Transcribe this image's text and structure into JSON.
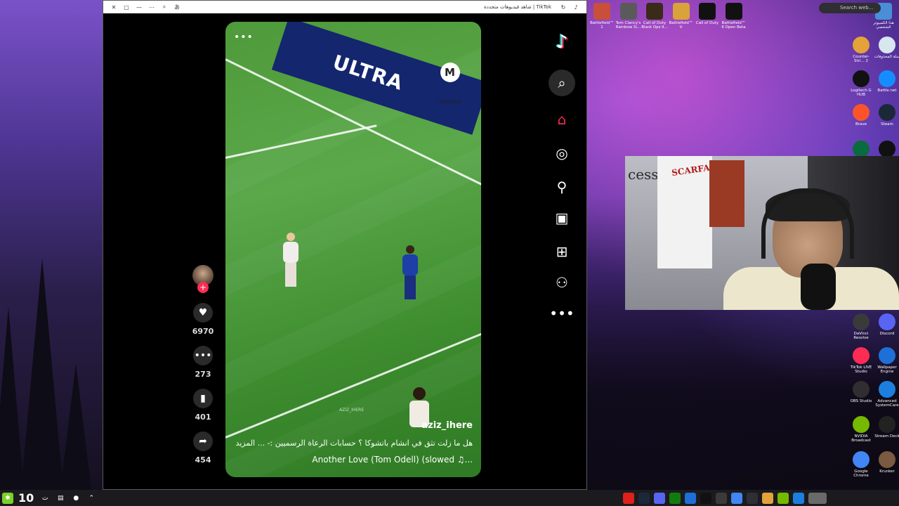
{
  "browser": {
    "title": "TikTok | شاهد فيديوهات متجددة",
    "controls": [
      "close",
      "restore",
      "minimize",
      "more",
      "zoom",
      "reader"
    ]
  },
  "video": {
    "banner_text": "ULTRA",
    "sponsor_label": "TASOOMA",
    "author": "aziz_ihere",
    "caption": "هل ما زلت تثق في انشام باتشوكا ؟ حسابات الرعاة الرسميين :- ...   المزيد",
    "music": "Another Love (Tom Odell) (slowed ♫...",
    "watermark": "AZIZ_IHERE"
  },
  "actions": {
    "likes": "6970",
    "comments": "273",
    "saves": "401",
    "shares": "454"
  },
  "nav": {
    "items": [
      "tiktok-logo",
      "search",
      "home",
      "explore",
      "following",
      "live",
      "upload",
      "profile",
      "more"
    ]
  },
  "desktop_top_icons": [
    {
      "label": "Battlefield™ 1",
      "color": "#c94f3a"
    },
    {
      "label": "Tom Clancy's Rainbow Si...",
      "color": "#5a5a5a"
    },
    {
      "label": "Call of Duty Black Ops II...",
      "color": "#3a2a1a"
    },
    {
      "label": "Battlefield™ V",
      "color": "#d9a23a"
    },
    {
      "label": "Call of Duty",
      "color": "#111111"
    },
    {
      "label": "Battlefield™ 6 Open Beta",
      "color": "#111111"
    }
  ],
  "desktop_right_icons": [
    {
      "label": "Counter-Stri... 2",
      "color": "#e3a23a"
    },
    {
      "label": "سلة المحذوفات",
      "color": "#d8e6f0"
    },
    {
      "label": "Logitech G HUB",
      "color": "#111111"
    },
    {
      "label": "Battle.net",
      "color": "#148eff"
    },
    {
      "label": "Brave",
      "color": "#fb542b"
    },
    {
      "label": "Steam",
      "color": "#1b2838"
    },
    {
      "label": "",
      "color": "#0a6a40"
    },
    {
      "label": "",
      "color": "#111111"
    },
    {
      "label": "DaVinci Resolve",
      "color": "#3a3a3a"
    },
    {
      "label": "Discord",
      "color": "#5865f2"
    },
    {
      "label": "TikTok LIVE Studio",
      "color": "#fe2c55"
    },
    {
      "label": "Wallpaper Engine",
      "color": "#1e6fd8"
    },
    {
      "label": "OBS Studio",
      "color": "#302e31"
    },
    {
      "label": "Advanced SystemCare",
      "color": "#1c7fe0"
    },
    {
      "label": "NVIDIA Broadcast",
      "color": "#76b900"
    },
    {
      "label": "Stream Deck",
      "color": "#222222"
    },
    {
      "label": "Google Chrome",
      "color": "#4285f4"
    },
    {
      "label": "Krunker",
      "color": "#7a5a40"
    }
  ],
  "desktop_top_right_label": "هذا الكمبيوتر الشخصي",
  "webcam": {
    "wall_text": "cess",
    "poster_text": "SCARFACE"
  },
  "taskbar": {
    "counter": "10",
    "search_placeholder": "Search web...",
    "time_hint": "ﺕ"
  }
}
